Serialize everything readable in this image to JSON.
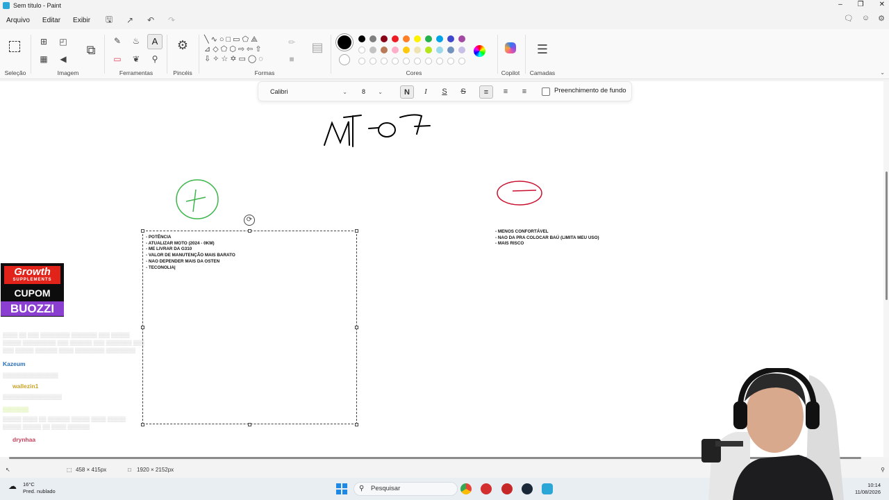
{
  "window": {
    "title": "Sem título - Paint"
  },
  "menu": [
    "Arquivo",
    "Editar",
    "Exibir"
  ],
  "ribbon": {
    "groups": [
      {
        "label": "Seleção"
      },
      {
        "label": "Imagem"
      },
      {
        "label": "Ferramentas"
      },
      {
        "label": "Pincéis"
      },
      {
        "label": "Formas"
      },
      {
        "label": "Cores"
      },
      {
        "label": "Copilot"
      },
      {
        "label": "Camadas"
      }
    ],
    "colors_row1": [
      "#000000",
      "#7f7f7f",
      "#880015",
      "#ed1c24",
      "#ff7f27",
      "#fff200",
      "#22b14c",
      "#00a2e8",
      "#3f48cc",
      "#a349a4"
    ],
    "colors_row2": [
      "#ffffff",
      "#c3c3c3",
      "#b97a57",
      "#ffaec9",
      "#ffc90e",
      "#efe4b0",
      "#b5e61d",
      "#99d9ea",
      "#7092be",
      "#c8bfe7"
    ],
    "primary_color": "#000000"
  },
  "textbar": {
    "font": "Calibri",
    "size": "8",
    "bold_label": "N",
    "italic_label": "I",
    "underline_label": "S",
    "strike_label": "S",
    "fill_label": "Preenchimento de fundo"
  },
  "canvas": {
    "pros_notes": "- POTÊNCIA\n- ATUALIZAR MOTO (2024 - 0KM)\n- ME LIVRAR DA G310\n- VALOR DE MANUTENÇÃO MAIS BARATO\n- NAO DEPENDER MAIS DA OSTEN\n- TECONOLIA|",
    "cons_notes": "- MENOS CONFORTÁVEL\n- NAO DA PRA COLOCAR BAÚ (LIMITA MEU USO)\n- MAIS RISCO"
  },
  "status": {
    "selection_size": "458 × 415px",
    "canvas_size": "1920 × 2152px"
  },
  "overlay": {
    "promo_brand": "Growth",
    "promo_sub": "SUPPLEMENTS",
    "promo_cupom": "CUPOM",
    "promo_code": "BUOZZI",
    "chat_users": [
      "Kazeum",
      "wallezin1",
      "drynhaa"
    ]
  },
  "taskbar": {
    "temperature": "16°C",
    "weather": "Pred. nublado",
    "search_placeholder": "Pesquisar",
    "time": "10:14",
    "date": "11/08/2026"
  }
}
